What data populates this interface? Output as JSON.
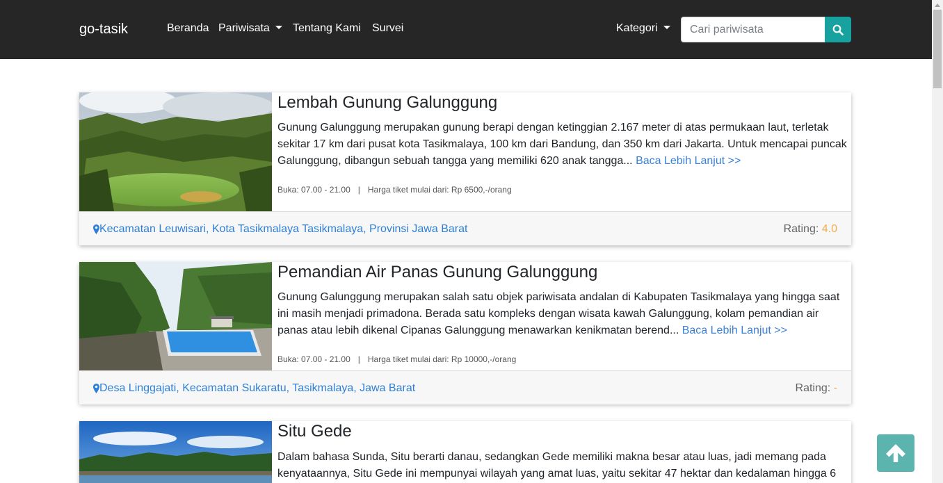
{
  "navbar": {
    "brand": "go-tasik",
    "links": [
      "Beranda",
      "Pariwisata",
      "Tentang Kami",
      "Survei"
    ],
    "category_label": "Kategori",
    "search_placeholder": "Cari pariwisata"
  },
  "places": [
    {
      "title": "Lembah Gunung Galunggung",
      "description": "Gunung Galunggung merupakan gunung berapi dengan ketinggian 2.167 meter di atas permukaan laut, terletak sekitar 17 km dari pusat kota Tasikmalaya, 100 km dari Bandung, dan 350 km dari Jakarta. Untuk mencapai puncak Galunggung, dibangun sebuah tangga yang memiliki 620 anak tangga...",
      "read_more": "Baca Lebih Lanjut >>",
      "hours": "Buka: 07.00 - 21.00",
      "separator": "|",
      "price": "Harga tiket mulai dari: Rp 6500,-/orang",
      "location": "Kecamatan Leuwisari, Kota Tasikmalaya Tasikmalaya, Provinsi Jawa Barat",
      "rating_label": "Rating:",
      "rating_value": "4.0"
    },
    {
      "title": "Pemandian Air Panas Gunung Galunggung",
      "description": "Gunung Galunggung merupakan salah satu objek pariwisata andalan di Kabupaten Tasikmalaya yang hingga saat ini masih menjadi primadona. Berada satu kompleks dengan wisata kawah Galunggung, kolam pemandian air panas atau lebih dikenal Cipanas Galunggung menawarkan kenikmatan berend...",
      "read_more": "Baca Lebih Lanjut >>",
      "hours": "Buka: 07.00 - 21.00",
      "separator": "|",
      "price": "Harga tiket mulai dari: Rp 10000,-/orang",
      "location": "Desa Linggajati, Kecamatan Sukaratu, Tasikmalaya, Jawa Barat",
      "rating_label": "Rating:",
      "rating_value": "-"
    },
    {
      "title": "Situ Gede",
      "description": "Dalam bahasa Sunda, Situ berarti danau, sedangkan Gede memiliki makna besar atau luas, jadi memang pada kenyataannya, Situ Gede ini mempunyai wilayah yang amat luas, yaitu sekitar 47 hektar dan kedalaman hingga 6"
    }
  ],
  "colors": {
    "navbar_bg": "#262626",
    "search_button": "#17a2a0",
    "link": "#2f7fd6",
    "rating_value": "#f0ad4e",
    "scroll_top_button": "#5bb5ae"
  },
  "icons": {
    "search": "search-icon",
    "location": "map-marker-icon",
    "scroll_top": "arrow-up-icon"
  }
}
